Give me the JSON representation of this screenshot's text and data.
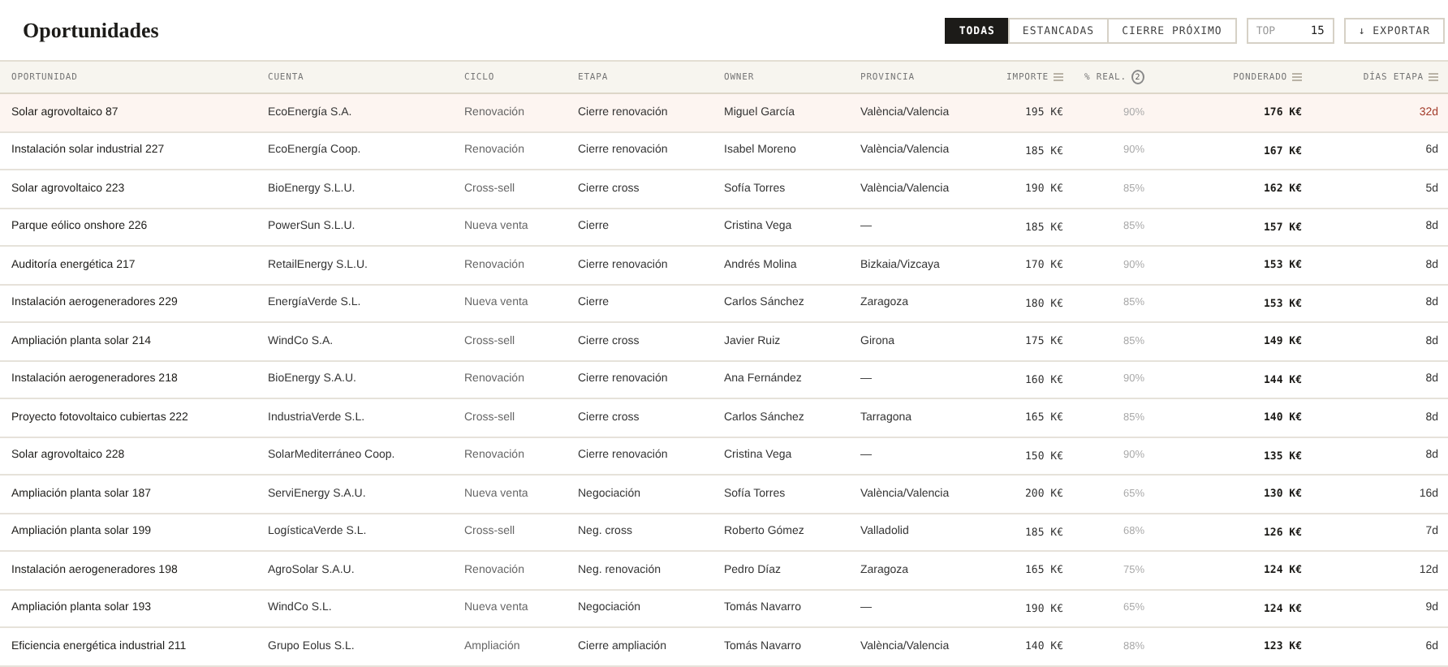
{
  "title": "Oportunidades",
  "filters": [
    {
      "label": "TODAS",
      "selected": true
    },
    {
      "label": "ESTANCADAS",
      "selected": false
    },
    {
      "label": "CIERRE PRÓXIMO",
      "selected": false
    }
  ],
  "top_field": {
    "label": "TOP",
    "value": "15"
  },
  "export_button": {
    "label": "↓ EXPORTAR"
  },
  "table": {
    "columns": [
      {
        "label": "OPORTUNIDAD",
        "sortable": false
      },
      {
        "label": "CUENTA",
        "sortable": false
      },
      {
        "label": "CICLO",
        "sortable": false
      },
      {
        "label": "ETAPA",
        "sortable": false
      },
      {
        "label": "OWNER",
        "sortable": false
      },
      {
        "label": "PROVINCIA",
        "sortable": false
      },
      {
        "label": "IMPORTE",
        "sortable": true
      },
      {
        "label": "% REAL.",
        "sortable": false,
        "badge": "2"
      },
      {
        "label": "PONDERADO",
        "sortable": true
      },
      {
        "label": "DÍAS ETAPA",
        "sortable": true
      }
    ],
    "rows": [
      {
        "flagged": true,
        "cells": [
          "Solar agrovoltaico 87",
          "EcoEnergía S.A.",
          "Renovación",
          "Cierre renovación",
          "Miguel García",
          "València/Valencia",
          "195 K€",
          "90%",
          "176 K€",
          "32d"
        ]
      },
      {
        "flagged": false,
        "cells": [
          "Instalación solar industrial 227",
          "EcoEnergía Coop.",
          "Renovación",
          "Cierre renovación",
          "Isabel Moreno",
          "València/Valencia",
          "185 K€",
          "90%",
          "167 K€",
          "6d"
        ]
      },
      {
        "flagged": false,
        "cells": [
          "Solar agrovoltaico 223",
          "BioEnergy S.L.U.",
          "Cross-sell",
          "Cierre cross",
          "Sofía Torres",
          "València/Valencia",
          "190 K€",
          "85%",
          "162 K€",
          "5d"
        ]
      },
      {
        "flagged": false,
        "cells": [
          "Parque eólico onshore 226",
          "PowerSun S.L.U.",
          "Nueva venta",
          "Cierre",
          "Cristina Vega",
          "—",
          "185 K€",
          "85%",
          "157 K€",
          "8d"
        ]
      },
      {
        "flagged": false,
        "cells": [
          "Auditoría energética 217",
          "RetailEnergy S.L.U.",
          "Renovación",
          "Cierre renovación",
          "Andrés Molina",
          "Bizkaia/Vizcaya",
          "170 K€",
          "90%",
          "153 K€",
          "8d"
        ]
      },
      {
        "flagged": false,
        "cells": [
          "Instalación aerogeneradores 229",
          "EnergíaVerde S.L.",
          "Nueva venta",
          "Cierre",
          "Carlos Sánchez",
          "Zaragoza",
          "180 K€",
          "85%",
          "153 K€",
          "8d"
        ]
      },
      {
        "flagged": false,
        "cells": [
          "Ampliación planta solar 214",
          "WindCo S.A.",
          "Cross-sell",
          "Cierre cross",
          "Javier Ruiz",
          "Girona",
          "175 K€",
          "85%",
          "149 K€",
          "8d"
        ]
      },
      {
        "flagged": false,
        "cells": [
          "Instalación aerogeneradores 218",
          "BioEnergy S.A.U.",
          "Renovación",
          "Cierre renovación",
          "Ana Fernández",
          "—",
          "160 K€",
          "90%",
          "144 K€",
          "8d"
        ]
      },
      {
        "flagged": false,
        "cells": [
          "Proyecto fotovoltaico cubiertas 222",
          "IndustriaVerde S.L.",
          "Cross-sell",
          "Cierre cross",
          "Carlos Sánchez",
          "Tarragona",
          "165 K€",
          "85%",
          "140 K€",
          "8d"
        ]
      },
      {
        "flagged": false,
        "cells": [
          "Solar agrovoltaico 228",
          "SolarMediterráneo Coop.",
          "Renovación",
          "Cierre renovación",
          "Cristina Vega",
          "—",
          "150 K€",
          "90%",
          "135 K€",
          "8d"
        ]
      },
      {
        "flagged": false,
        "cells": [
          "Ampliación planta solar 187",
          "ServiEnergy S.A.U.",
          "Nueva venta",
          "Negociación",
          "Sofía Torres",
          "València/Valencia",
          "200 K€",
          "65%",
          "130 K€",
          "16d"
        ]
      },
      {
        "flagged": false,
        "cells": [
          "Ampliación planta solar 199",
          "LogísticaVerde S.L.",
          "Cross-sell",
          "Neg. cross",
          "Roberto Gómez",
          "Valladolid",
          "185 K€",
          "68%",
          "126 K€",
          "7d"
        ]
      },
      {
        "flagged": false,
        "cells": [
          "Instalación aerogeneradores 198",
          "AgroSolar S.A.U.",
          "Renovación",
          "Neg. renovación",
          "Pedro Díaz",
          "Zaragoza",
          "165 K€",
          "75%",
          "124 K€",
          "12d"
        ]
      },
      {
        "flagged": false,
        "cells": [
          "Ampliación planta solar 193",
          "WindCo S.L.",
          "Nueva venta",
          "Negociación",
          "Tomás Navarro",
          "—",
          "190 K€",
          "65%",
          "124 K€",
          "9d"
        ]
      },
      {
        "flagged": false,
        "cells": [
          "Eficiencia energética industrial 211",
          "Grupo Eolus S.L.",
          "Ampliación",
          "Cierre ampliación",
          "Tomás Navarro",
          "València/Valencia",
          "140 K€",
          "88%",
          "123 K€",
          "6d"
        ]
      }
    ]
  }
}
